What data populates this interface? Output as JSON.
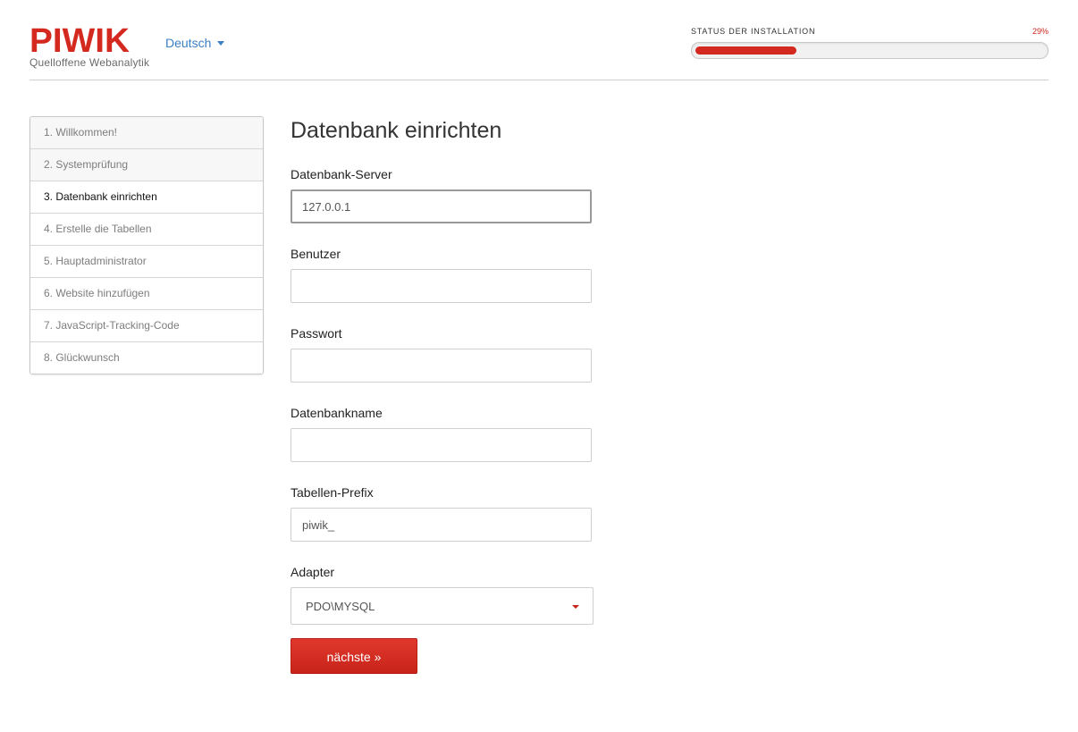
{
  "header": {
    "logo_text": "PIWIK",
    "tagline": "Quelloffene Webanalytik",
    "language": "Deutsch"
  },
  "install_status": {
    "label": "STATUS DER INSTALLATION",
    "percent_label": "29%",
    "progress_fraction": 0.29,
    "accent_color": "#d4291f"
  },
  "steps": [
    {
      "label": "1. Willkommen!",
      "state": "done"
    },
    {
      "label": "2. Systemprüfung",
      "state": "done"
    },
    {
      "label": "3. Datenbank einrichten",
      "state": "current"
    },
    {
      "label": "4. Erstelle die Tabellen",
      "state": "pending"
    },
    {
      "label": "5. Hauptadministrator",
      "state": "pending"
    },
    {
      "label": "6. Website hinzufügen",
      "state": "pending"
    },
    {
      "label": "7. JavaScript-Tracking-Code",
      "state": "pending"
    },
    {
      "label": "8. Glückwunsch",
      "state": "pending"
    }
  ],
  "form": {
    "title": "Datenbank einrichten",
    "server_label": "Datenbank-Server",
    "server_value": "127.0.0.1",
    "user_label": "Benutzer",
    "user_value": "",
    "password_label": "Passwort",
    "password_value": "",
    "dbname_label": "Datenbankname",
    "dbname_value": "",
    "prefix_label": "Tabellen-Prefix",
    "prefix_value": "piwik_",
    "adapter_label": "Adapter",
    "adapter_value": "PDO\\MYSQL",
    "next_button": "nächste »"
  }
}
